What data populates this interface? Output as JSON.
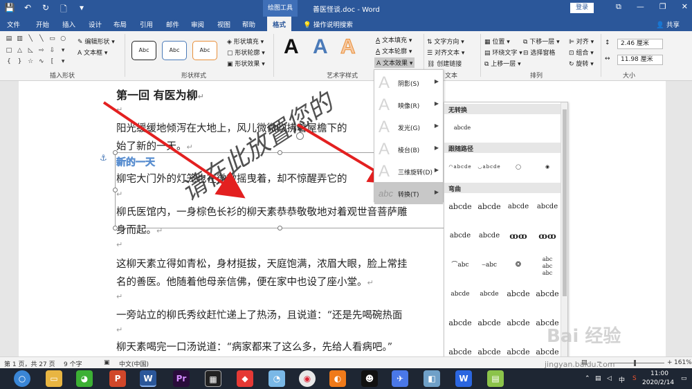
{
  "titlebar": {
    "context_tools": "绘图工具",
    "doc_title": "善医怪谈.doc - Word",
    "login": "登录",
    "qat": {
      "save": "💾",
      "undo": "↶",
      "redo": "↻",
      "new": "🗋",
      "more": "▾"
    },
    "win": {
      "ribbon_opts": "⧉",
      "minimize": "—",
      "restore": "❐",
      "close": "✕"
    }
  },
  "tabs": [
    "文件",
    "开始",
    "插入",
    "设计",
    "布局",
    "引用",
    "邮件",
    "审阅",
    "视图",
    "帮助",
    "格式"
  ],
  "tell_me": "操作说明搜索",
  "share": "共享",
  "ribbon": {
    "insert_shapes": {
      "label": "插入形状",
      "edit_shape": "编辑形状",
      "textbox": "文本框"
    },
    "shape_styles": {
      "label": "形状样式",
      "samples": [
        "Abc",
        "Abc",
        "Abc"
      ],
      "fill": "形状填充",
      "outline": "形状轮廓",
      "effects": "形状效果"
    },
    "wordart": {
      "label": "艺术字样式",
      "samples": [
        "A",
        "A",
        "A"
      ],
      "text_fill": "文本填充",
      "text_outline": "文本轮廓",
      "text_effects": "文本效果"
    },
    "text": {
      "label": "文本",
      "direction": "文字方向",
      "align": "对齐文本",
      "link": "创建链接"
    },
    "arrange": {
      "label": "排列",
      "position": "位置",
      "wrap": "环绕文字",
      "forward": "上移一层",
      "backward": "下移一层",
      "selection": "选择窗格",
      "align": "对齐",
      "group": "组合",
      "rotate": "旋转"
    },
    "size": {
      "label": "大小",
      "height": "2.46 厘米",
      "width": "11.98 厘米"
    }
  },
  "document": {
    "heading": "第一回  有医为柳",
    "lines": [
      "阳光缓缓地倾泻在大地上，风儿微微吹拂着屋檐下的",
      "始了新的一天。",
      "柳宅大门外的灯笼也在微微摇曳着，却不惊醒弄它的",
      "柳氏医馆内，一身棕色长衫的柳天素恭恭敬敬地对着观世音菩萨雕",
      "身而起。",
      "这柳天素立得如青松，身材挺拔，天庭饱满，浓眉大眼，脸上常挂",
      "名的善医。他随着他母亲信佛，便在家中也设了座小堂。",
      "一旁站立的柳氏秀纹赶忙递上了热汤，且说道：“还是先喝碗热面",
      "柳天素喝完一口汤说道：“病家都来了这么多，先给人看病吧。”"
    ],
    "wordart_text": "新的一天",
    "para_mark": "↵",
    "anchor": "⚓",
    "watermark": "请在此放置您的"
  },
  "text_effects_menu": [
    {
      "label": "阴影(S)",
      "glyph": "A"
    },
    {
      "label": "映像(R)",
      "glyph": "A"
    },
    {
      "label": "发光(G)",
      "glyph": "A"
    },
    {
      "label": "棱台(B)",
      "glyph": "A"
    },
    {
      "label": "三维旋转(D)",
      "glyph": "A"
    },
    {
      "label": "转换(T)",
      "glyph": "abc"
    }
  ],
  "transform_gallery": {
    "no_transform": "无转换",
    "no_transform_sample": "abcde",
    "follow_path": "跟随路径",
    "warp": "弯曲",
    "sample": "abcde"
  },
  "status": {
    "page": "第 1 页，共 27 页",
    "words": "9 个字",
    "lang": "中文(中国)",
    "zoom": "161%"
  },
  "taskbar": {
    "time": "11:00",
    "date": "2020/2/14",
    "ime": "中"
  },
  "branding": {
    "logo": "Bai 经验",
    "url": "jingyan.baidu.com"
  }
}
